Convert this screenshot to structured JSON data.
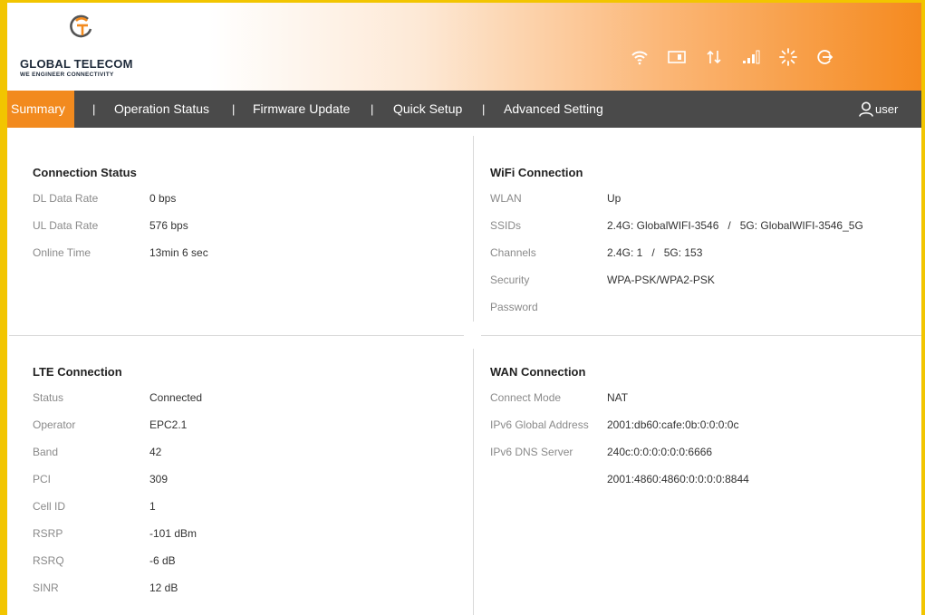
{
  "brand": {
    "name": "GLOBAL TELECOM",
    "tagline": "WE ENGINEER CONNECTIVITY",
    "accent": "#f28a1e"
  },
  "status_icons": [
    "wifi-icon",
    "sim-card-icon",
    "data-transfer-icon",
    "signal-strength-icon",
    "loading-icon",
    "logout-icon"
  ],
  "nav": {
    "items": [
      {
        "label": "Summary"
      },
      {
        "label": "Operation Status"
      },
      {
        "label": "Firmware Update"
      },
      {
        "label": "Quick Setup"
      },
      {
        "label": "Advanced Setting"
      }
    ],
    "separator": "|",
    "user_label": "user"
  },
  "connection_status": {
    "title": "Connection Status",
    "rows": [
      {
        "label": "DL Data Rate",
        "value": "0 bps"
      },
      {
        "label": "UL Data Rate",
        "value": "576 bps"
      },
      {
        "label": "Online Time",
        "value": "13min 6 sec"
      }
    ]
  },
  "wifi_connection": {
    "title": "WiFi Connection",
    "rows": [
      {
        "label": "WLAN",
        "value": "Up"
      },
      {
        "label": "SSIDs",
        "value": "2.4G: GlobalWIFI-3546   /   5G: GlobalWIFI-3546_5G"
      },
      {
        "label": "Channels",
        "value": "2.4G: 1   /   5G: 153"
      },
      {
        "label": "Security",
        "value": "WPA-PSK/WPA2-PSK"
      },
      {
        "label": "Password",
        "value": ""
      }
    ]
  },
  "lte_connection": {
    "title": "LTE Connection",
    "rows": [
      {
        "label": "Status",
        "value": "Connected"
      },
      {
        "label": "Operator",
        "value": "EPC2.1"
      },
      {
        "label": "Band",
        "value": "42"
      },
      {
        "label": "PCI",
        "value": "309"
      },
      {
        "label": "Cell ID",
        "value": "1"
      },
      {
        "label": "RSRP",
        "value": "-101 dBm"
      },
      {
        "label": "RSRQ",
        "value": "-6 dB"
      },
      {
        "label": "SINR",
        "value": "12 dB"
      }
    ]
  },
  "wan_connection": {
    "title": "WAN Connection",
    "rows": [
      {
        "label": "Connect Mode",
        "value": "NAT"
      },
      {
        "label": "IPv6 Global Address",
        "value": "2001:db60:cafe:0b:0:0:0:0c"
      },
      {
        "label": "IPv6 DNS Server",
        "value": "240c:0:0:0:0:0:0:6666"
      },
      {
        "label": "",
        "value": "2001:4860:4860:0:0:0:0:8844"
      }
    ]
  }
}
